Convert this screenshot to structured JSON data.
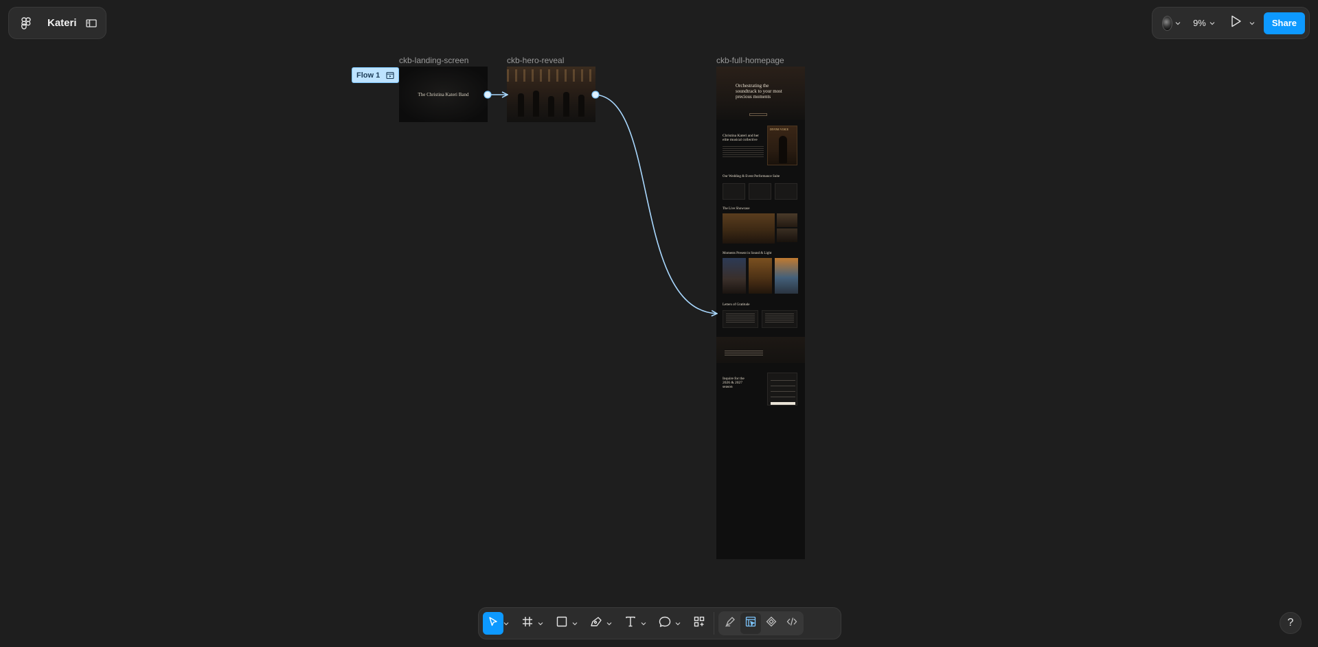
{
  "app": {
    "project_name": "Kateri"
  },
  "header": {
    "zoom": "9%",
    "share_label": "Share",
    "icons": [
      "figma-menu-icon",
      "sidebar-toggle-icon",
      "avatar",
      "chevron-down-icon",
      "play-icon"
    ]
  },
  "canvas": {
    "flow_label": "Flow 1",
    "frames": [
      {
        "name": "ckb-landing-screen",
        "title_text": "The Christina Kateri Band"
      },
      {
        "name": "ckb-hero-reveal"
      },
      {
        "name": "ckb-full-homepage",
        "hero_headline": "Orchestrating the soundtrack to your most precious moments",
        "about_heading": "Christina Kateri and her elite musical collective",
        "portrait_caption": "DIVINE VOICE",
        "services_heading": "Our Wedding & Event Performance Suite",
        "live_heading": "The Live Showcase",
        "gallery_heading": "Moments Present in Sound & Light",
        "testimonials_heading": "Letters of Gratitude",
        "contact_heading": "Inquire for the 2026 & 2027 season"
      }
    ]
  },
  "toolbar": {
    "tools": [
      "move-tool",
      "frame-tool",
      "rectangle-tool",
      "pen-tool",
      "text-tool",
      "comment-tool",
      "actions-tool"
    ],
    "modes": [
      "draw-mode",
      "design-mode",
      "prototype-mode",
      "dev-mode"
    ],
    "active_tool": "move-tool",
    "active_mode": "design-mode"
  },
  "help_label": "?",
  "colors": {
    "canvas_bg": "#1e1e1e",
    "panel_bg": "#2c2c2c",
    "accent": "#0d99ff",
    "flow_tag_bg": "#bde3ff",
    "connector": "#a9d8ff"
  }
}
